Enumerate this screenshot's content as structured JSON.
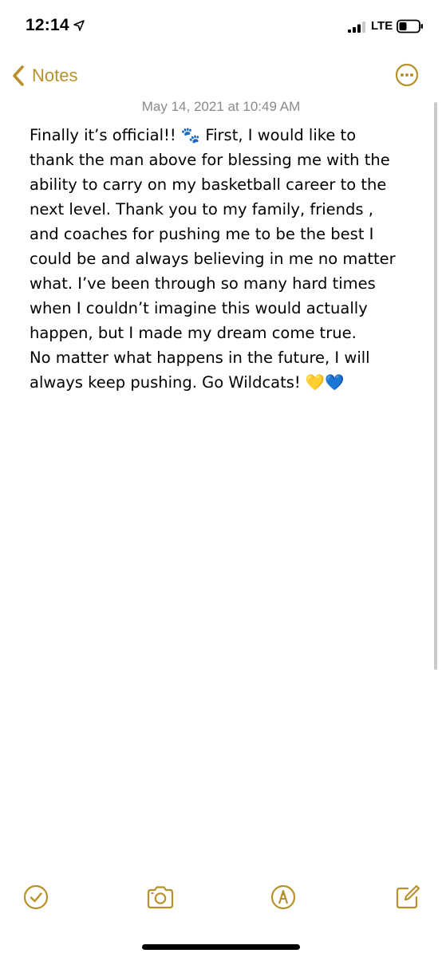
{
  "status_bar": {
    "time": "12:14",
    "network": "LTE",
    "icons": [
      "location-arrow-icon",
      "cellular-signal-icon",
      "battery-icon"
    ]
  },
  "nav": {
    "back_label": "Notes",
    "back_icon": "chevron-left-icon",
    "more_icon": "ellipsis-circle-icon"
  },
  "note": {
    "date": "May 14, 2021 at 10:49 AM",
    "body": "Finally it’s official!! 🐾 First, I would like to\nthank the man above for blessing me with the\nability to carry on my basketball career to the\nnext level. Thank you to my family, friends ,\nand coaches for pushing me to be the best I\ncould be and always believing in me no matter\nwhat. I’ve been through so many hard times\nwhen I couldn’t imagine this would actually\nhappen,  but I made my dream come true.\nNo matter what happens in the future, I will\nalways keep pushing. Go Wildcats! 💛💙"
  },
  "toolbar": {
    "items": [
      {
        "icon": "checklist-icon"
      },
      {
        "icon": "camera-icon"
      },
      {
        "icon": "markup-pen-icon"
      },
      {
        "icon": "compose-icon"
      }
    ]
  },
  "colors": {
    "accent": "#b8912a",
    "date_text": "#8a8a8e",
    "body_text": "#000000",
    "background": "#ffffff"
  }
}
